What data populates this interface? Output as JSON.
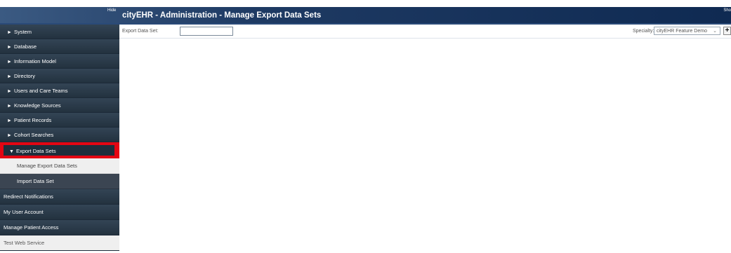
{
  "header": {
    "hide_label": "Hide",
    "show_label": "Sho",
    "title": "cityEHR - Administration - Manage Export Data Sets"
  },
  "sidebar": {
    "items": [
      {
        "label": "System",
        "arrow": "►"
      },
      {
        "label": "Database",
        "arrow": "►"
      },
      {
        "label": "Information Model",
        "arrow": "►"
      },
      {
        "label": "Directory",
        "arrow": "►"
      },
      {
        "label": "Users and Care Teams",
        "arrow": "►"
      },
      {
        "label": "Knowledge Sources",
        "arrow": "►"
      },
      {
        "label": "Patient Records",
        "arrow": "►"
      },
      {
        "label": "Cohort Searches",
        "arrow": "►"
      },
      {
        "label": "Export Data Sets",
        "arrow": "▼"
      }
    ],
    "sub_items": [
      {
        "label": "Manage Export Data Sets"
      },
      {
        "label": "Import Data Set"
      }
    ],
    "flat_items": [
      {
        "label": "Redirect Notifications"
      },
      {
        "label": "My User Account"
      },
      {
        "label": "Manage Patient Access"
      },
      {
        "label": "Test Web Service"
      }
    ]
  },
  "toolbar": {
    "export_label": "Export Data Set:",
    "export_value": "",
    "specialty_label": "Specialty:",
    "specialty_value": "cityEHR Feature Demo",
    "add_symbol": "+"
  },
  "colors": {
    "header_dark": "#0f2a52",
    "sidebar_bg": "#2a3a4a",
    "highlight": "#e30613"
  }
}
